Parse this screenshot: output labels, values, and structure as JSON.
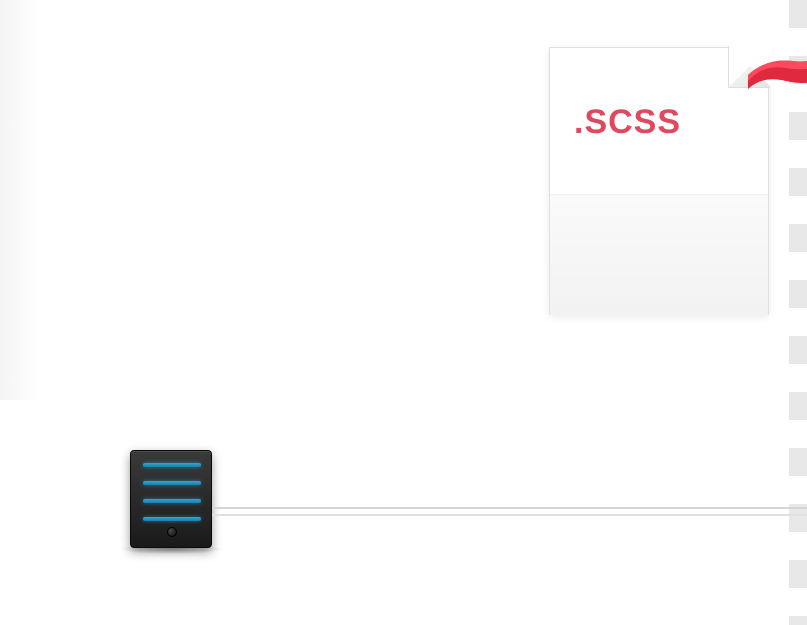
{
  "file": {
    "extension_label": ".SCSS"
  },
  "colors": {
    "accent_red": "#e2485d",
    "server_light": "#2ba8d8"
  }
}
